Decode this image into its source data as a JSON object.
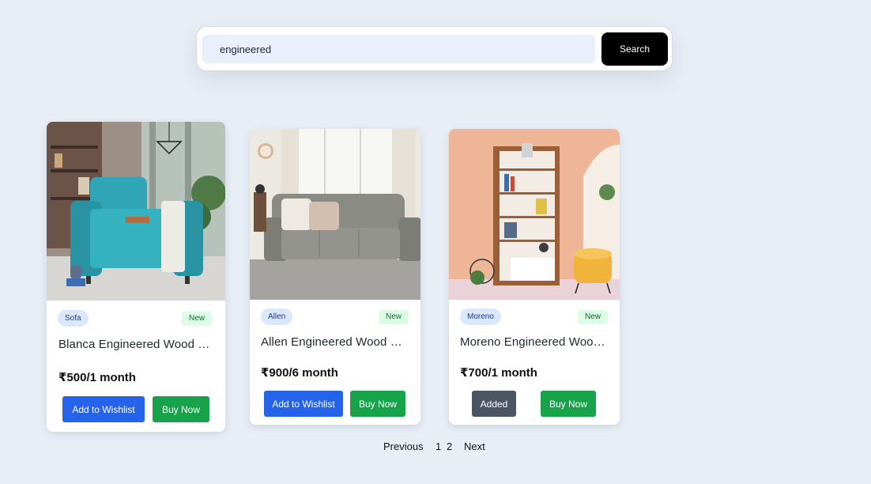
{
  "search": {
    "value": "engineered",
    "button_label": "Search"
  },
  "products": [
    {
      "category": "Sofa",
      "badge": "New",
      "title": "Blanca Engineered Wood Single Seater Sofa",
      "price": "₹500/1 month",
      "wishlist_label": "Add to Wishlist",
      "buy_label": "Buy Now"
    },
    {
      "category": "Allen",
      "badge": "New",
      "title": "Allen Engineered Wood Sofa Cum Bed",
      "price": "₹900/6 month",
      "wishlist_label": "Add to Wishlist",
      "buy_label": "Buy Now"
    },
    {
      "category": "Moreno",
      "badge": "New",
      "title": "Moreno Engineered Wood Bookshelf",
      "price": "₹700/1 month",
      "wishlist_label": "Added",
      "buy_label": "Buy Now"
    }
  ],
  "pagination": {
    "previous": "Previous",
    "pages": [
      "1",
      "2"
    ],
    "next": "Next"
  },
  "colors": {
    "page_bg": "#e8eef6",
    "wishlist": "#2563eb",
    "buy": "#16a34a",
    "added": "#4b5563",
    "search_button": "#000000"
  }
}
